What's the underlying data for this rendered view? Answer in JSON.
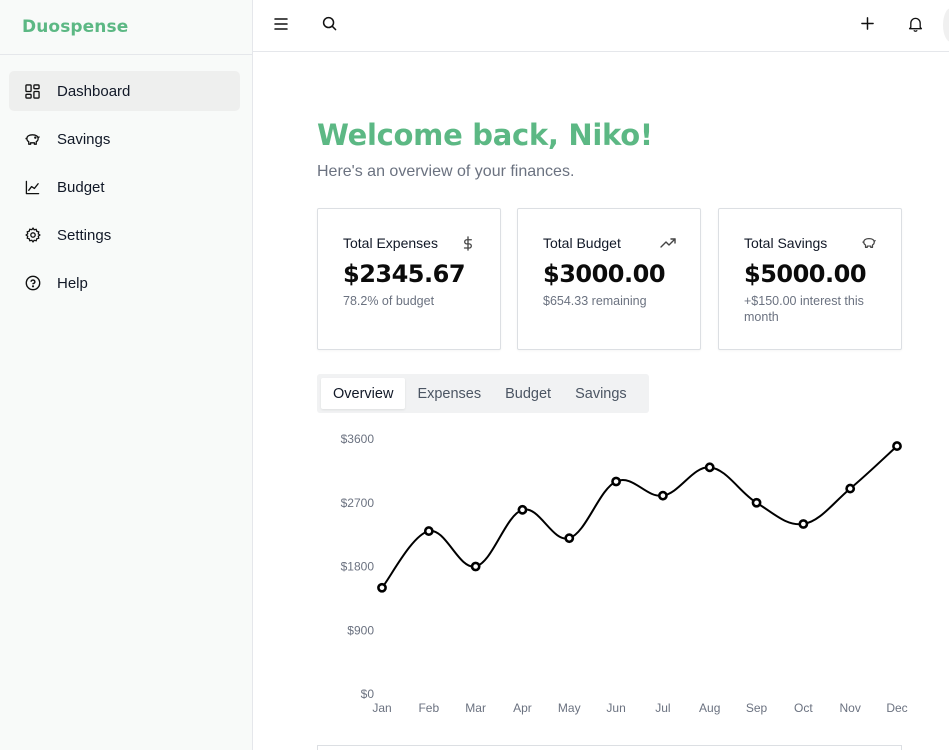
{
  "brand": "Duospense",
  "sidebar": {
    "items": [
      {
        "label": "Dashboard",
        "icon": "dashboard-icon",
        "active": true
      },
      {
        "label": "Savings",
        "icon": "piggy-bank-icon"
      },
      {
        "label": "Budget",
        "icon": "line-chart-icon"
      },
      {
        "label": "Settings",
        "icon": "gear-icon"
      },
      {
        "label": "Help",
        "icon": "help-circle-icon"
      }
    ]
  },
  "header": {
    "menu_icon": "hamburger-menu-icon",
    "search_icon": "search-icon",
    "add_icon": "plus-icon",
    "notifications_icon": "bell-icon"
  },
  "welcome": {
    "title": "Welcome back, Niko!",
    "subtitle": "Here's an overview of your finances."
  },
  "cards": [
    {
      "title": "Total Expenses",
      "icon": "dollar-icon",
      "value": "$2345.67",
      "sub": "78.2% of budget"
    },
    {
      "title": "Total Budget",
      "icon": "trending-up-icon",
      "value": "$3000.00",
      "sub": "$654.33 remaining"
    },
    {
      "title": "Total Savings",
      "icon": "piggy-bank-icon",
      "value": "$5000.00",
      "sub": "+$150.00 interest this month"
    }
  ],
  "tabs": [
    {
      "label": "Overview",
      "active": true
    },
    {
      "label": "Expenses"
    },
    {
      "label": "Budget"
    },
    {
      "label": "Savings"
    }
  ],
  "colors": {
    "accent": "#5cb884",
    "line": "#000000"
  },
  "chart_data": {
    "type": "line",
    "categories": [
      "Jan",
      "Feb",
      "Mar",
      "Apr",
      "May",
      "Jun",
      "Jul",
      "Aug",
      "Sep",
      "Oct",
      "Nov",
      "Dec"
    ],
    "values": [
      1500,
      2300,
      1800,
      2600,
      2200,
      3000,
      2800,
      3200,
      2700,
      2400,
      2900,
      3500
    ],
    "y_ticks": [
      "$0",
      "$900",
      "$1800",
      "$2700",
      "$3600"
    ],
    "ylim": [
      0,
      3600
    ],
    "grid": false,
    "title": "",
    "xlabel": "",
    "ylabel": ""
  }
}
